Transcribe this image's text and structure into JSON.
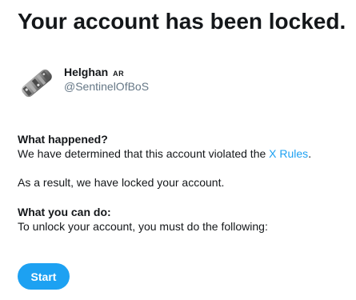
{
  "page": {
    "title": "Your account has been locked."
  },
  "profile": {
    "display_name": "Helghan",
    "name_suffix": "AR",
    "handle": "@SentinelOfBoS",
    "avatar_icon": "rubble-avatar-icon"
  },
  "what_happened": {
    "heading": "What happened?",
    "text_before_link": "We have determined that this account violated the ",
    "link_text": "X Rules",
    "text_after_link": "."
  },
  "result_text": "As a result, we have locked your account.",
  "what_you_can_do": {
    "heading": "What you can do:",
    "text": "To unlock your account, you must do the following:"
  },
  "actions": {
    "start_label": "Start"
  },
  "colors": {
    "accent": "#1da1f2",
    "text": "#14171a",
    "muted": "#657786"
  }
}
